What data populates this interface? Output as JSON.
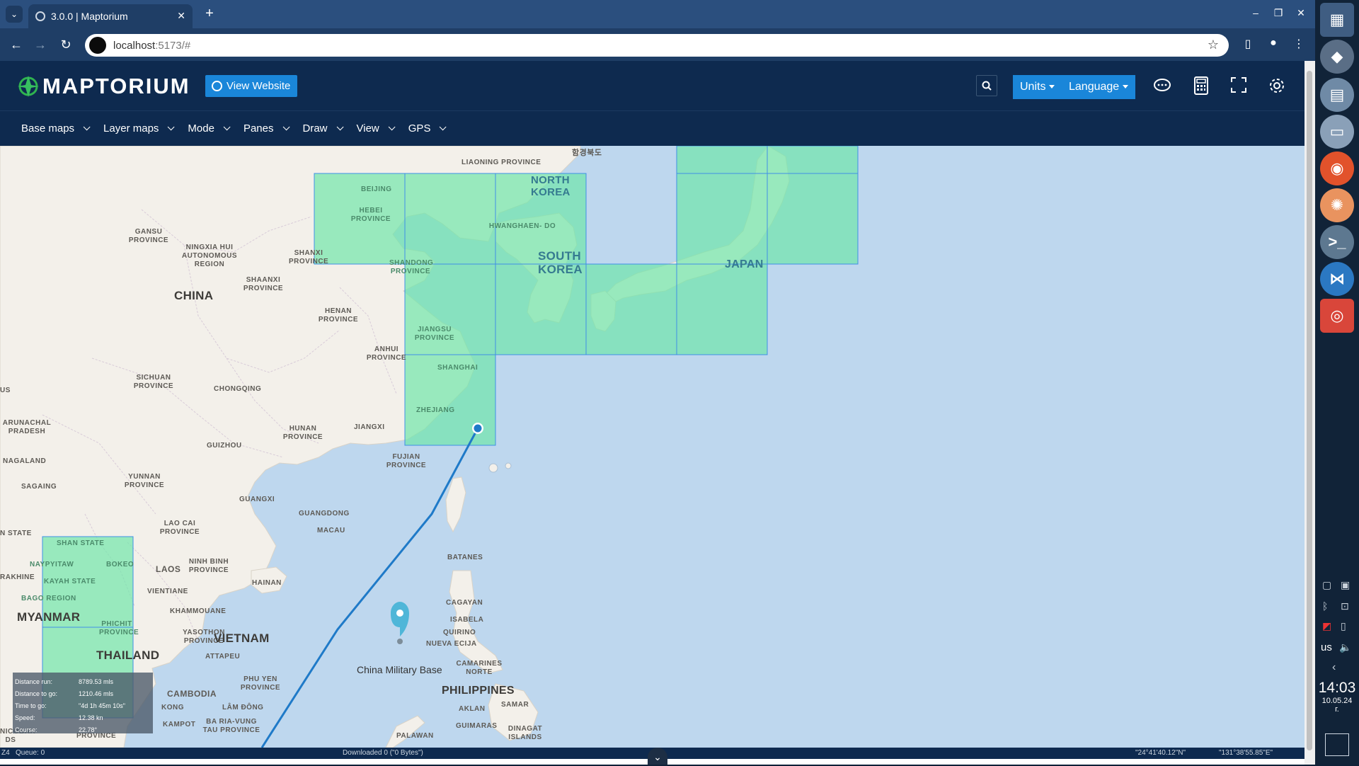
{
  "browser": {
    "tab_title": "3.0.0 | Maptorium",
    "url_host": "localhost",
    "url_rest": ":5173/#"
  },
  "header": {
    "logo_text": "MAPTORIUM",
    "view_website": "View Website",
    "units": "Units",
    "language": "Language"
  },
  "menu": [
    "Base maps",
    "Layer maps",
    "Mode",
    "Panes",
    "Draw",
    "View",
    "GPS"
  ],
  "map": {
    "labels": {
      "liaoning": "LIAONING PROVINCE",
      "hangul": "함경북도",
      "north_korea": "NORTH KOREA",
      "beijing": "BEIJING",
      "hebei": "HEBEI PROVINCE",
      "gansu": "GANSU PROVINCE",
      "ningxia": "NINGXIA HUI AUTONOMOUS REGION",
      "shanxi": "SHANXI PROVINCE",
      "hwanghae": "HWANGHAEN- DO",
      "south_korea": "SOUTH KOREA",
      "shandong": "SHANDONG PROVINCE",
      "japan": "JAPAN",
      "shaanxi": "SHAANXI PROVINCE",
      "china": "CHINA",
      "henan": "HENAN PROVINCE",
      "jiangsu": "JIANGSU PROVINCE",
      "anhui": "ANHUI PROVINCE",
      "shanghai": "SHANGHAI",
      "sichuan": "SICHUAN PROVINCE",
      "chongqing": "CHONGQING",
      "zhejiang": "ZHEJIANG",
      "us_edge": "US",
      "arunachal": "ARUNACHAL PRADESH",
      "hunan": "HUNAN PROVINCE",
      "jiangxi": "JIANGXI",
      "guizhou": "GUIZHOU",
      "fujian": "FUJIAN PROVINCE",
      "nagaland": "NAGALAND",
      "yunnan": "YUNNAN PROVINCE",
      "sagaing": "SAGAING",
      "guangxi": "GUANGXI",
      "guangdong": "GUANGDONG",
      "lao_cai": "LAO CAI PROVINCE",
      "macau": "MACAU",
      "n_state": "N STATE",
      "shan_state": "SHAN STATE",
      "batanes": "BATANES",
      "naypyitaw": "NAYPYITAW",
      "bokeo": "BOKEO",
      "laos": "LAOS",
      "ninh_binh": "NINH BINH PROVINCE",
      "rakhine": "RAKHINE",
      "kayah": "KAYAH STATE",
      "hainan": "HAINAN",
      "vientiane": "VIENTIANE",
      "bago": "BAGO REGION",
      "cagayan": "CAGAYAN",
      "myanmar": "MYANMAR",
      "khammouane": "KHAMMOUANE",
      "isabela": "ISABELA",
      "phichit": "PHICHIT PROVINCE",
      "quirino": "QUIRINO",
      "yasothon": "YASOTHON PROVINCE",
      "vietnam": "VIETNAM",
      "nueva_ecija": "NUEVA ECIJA",
      "thailand": "THAILAND",
      "attapeu": "ATTAPEU",
      "camarines": "CAMARINES NORTE",
      "phu_yen": "PHU YEN PROVINCE",
      "philippines": "PHILIPPINES",
      "cambodia": "CAMBODIA",
      "samar": "SAMAR",
      "kong": "KONG",
      "lam_dong": "LÂM ĐÔNG",
      "aklan": "AKLAN",
      "kampot": "KAMPOT",
      "ba_ria": "BA RIA-VUNG TAU PROVINCE",
      "guimaras": "GUIMARAS",
      "dinagat": "DINAGAT ISLANDS",
      "palawan": "PALAWAN",
      "nicobar": "NICOBAR DS",
      "province_frag": "PROVINCE"
    },
    "marker_label": "China Military Base"
  },
  "gps_info": [
    {
      "key": "Distance run:",
      "value": "8789.53 mls"
    },
    {
      "key": "Distance to go:",
      "value": "1210.46 mls"
    },
    {
      "key": "Time to go:",
      "value": "\"4d 1h 45m 10s\""
    },
    {
      "key": "Speed:",
      "value": "12.38 kn"
    },
    {
      "key": "Course:",
      "value": "22.78°"
    }
  ],
  "status": {
    "zoom": "Z4",
    "queue": "Queue: 0",
    "downloaded": "Downloaded 0 (\"0 Bytes\")",
    "lat": "\"24°41'40.12\"N\"",
    "lon": "\"131°38'55.85\"E\""
  },
  "taskbar": {
    "keyboard": "us",
    "time": "14:03",
    "date": "10.05.24",
    "date_suffix": "г."
  }
}
